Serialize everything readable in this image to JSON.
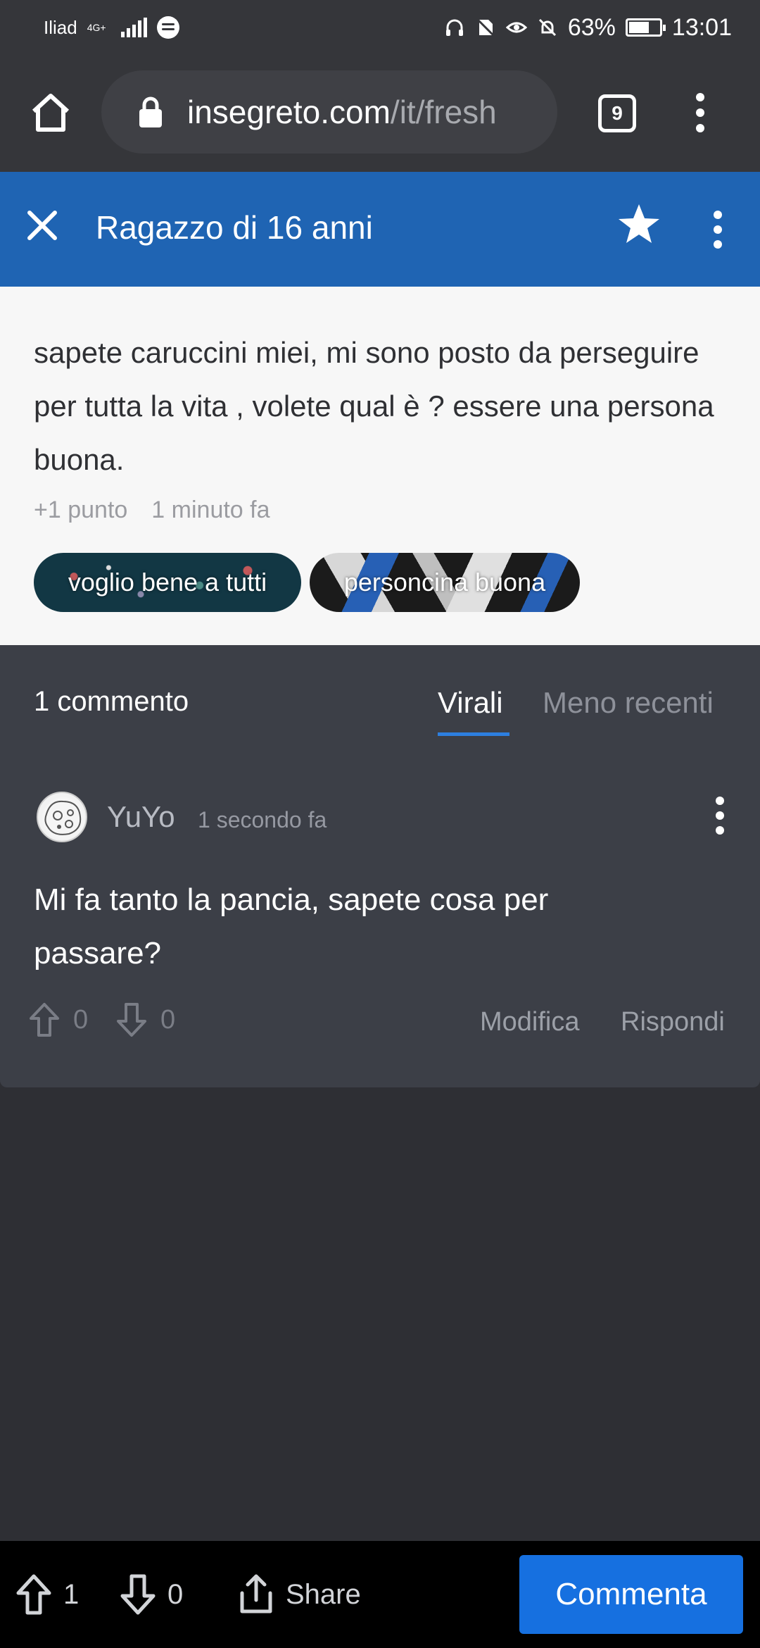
{
  "status_bar": {
    "carrier": "Iliad",
    "network": "4G+",
    "battery": "63%",
    "time": "13:01",
    "battery_level": 0.63
  },
  "browser": {
    "url_domain": "insegreto.com",
    "url_path": "/it/fresh",
    "tab_count": "9"
  },
  "header": {
    "title": "Ragazzo di 16 anni"
  },
  "post": {
    "text": "sapete caruccini miei, mi sono posto da perseguire per tutta la vita , volete qual è ? essere una persona buona.",
    "points": "+1 punto",
    "time": "1 minuto fa",
    "tags": [
      "voglio bene a tutti",
      "personcina buona"
    ]
  },
  "comments": {
    "count_label": "1 commento",
    "tabs": [
      "Virali",
      "Meno recenti"
    ],
    "active_tab": "Virali",
    "items": [
      {
        "author": "YuYo",
        "time": "1 secondo fa",
        "text": "Mi fa tanto la pancia, sapete cosa per passare?",
        "upvotes": "0",
        "downvotes": "0",
        "edit_label": "Modifica",
        "reply_label": "Rispondi"
      }
    ]
  },
  "bottom_bar": {
    "upvotes": "1",
    "downvotes": "0",
    "share_label": "Share",
    "comment_label": "Commenta"
  },
  "colors": {
    "header_bg": "#1f64b3",
    "accent": "#1670e0",
    "comment_bg": "#3c3f47",
    "page_bg": "#2e2f34"
  }
}
